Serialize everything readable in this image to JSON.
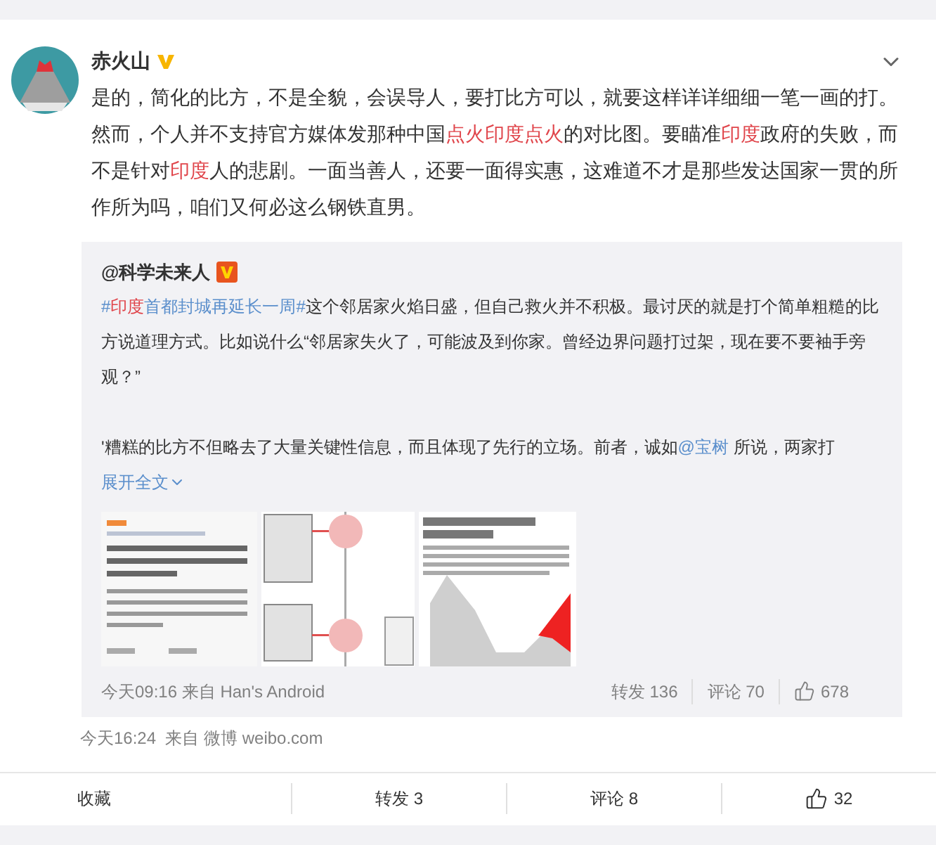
{
  "post": {
    "author": "赤火山",
    "verified": true,
    "body": [
      {
        "kind": "plain",
        "text": "是的，简化的比方，不是全貌，会误导人，要打比方可以，就要这样详详细细一笔一画的打。然而，个人并不支持官方媒体发那种中国"
      },
      {
        "kind": "highlight",
        "text": "点火印度点火"
      },
      {
        "kind": "plain",
        "text": "的对比图。要瞄准"
      },
      {
        "kind": "highlight",
        "text": "印度"
      },
      {
        "kind": "plain",
        "text": "政府的失败，而不是针对"
      },
      {
        "kind": "highlight",
        "text": "印度"
      },
      {
        "kind": "plain",
        "text": "人的悲剧。一面当善人，还要一面得实惠，这难道不才是那些发达国家一贯的所作所为吗，咱们又何必这么钢铁直男。"
      }
    ],
    "repost": {
      "author": "@科学未来人",
      "verified": true,
      "paragraphs": [
        [
          {
            "kind": "link",
            "text": "#"
          },
          {
            "kind": "highlight",
            "text": "印度"
          },
          {
            "kind": "link",
            "text": "首都封城再延长一周#"
          },
          {
            "kind": "plain",
            "text": "这个邻居家火焰日盛，但自己救火并不积极。最讨厌的就是打个简单粗糙的比方说道理方式。比如说什么“邻居家失火了，可能波及到你家。曾经边界问题打过架，现在要不要袖手旁观？”"
          }
        ],
        [
          {
            "kind": "plain",
            "text": "'糟糕的比方不但略去了大量关键性信息，而且体现了先行的立场。前者，诚如"
          },
          {
            "kind": "link",
            "text": "@宝树"
          },
          {
            "kind": "plain",
            "text": " 所说，两家打 "
          }
        ]
      ],
      "expand": "展开全文",
      "images": [
        {
          "kind": "picture"
        },
        {
          "kind": "picture"
        },
        {
          "kind": "picture"
        }
      ],
      "time": "今天09:16 来自 Han's Android",
      "stats": [
        {
          "kind": "text",
          "label": "转发 136"
        },
        {
          "kind": "text",
          "label": "评论 70"
        },
        {
          "kind": "like",
          "label": "678"
        }
      ]
    },
    "time": "今天16:24  来自 微博 weibo.com",
    "actions": [
      {
        "kind": "text",
        "label": "收藏"
      },
      {
        "kind": "text",
        "label": "转发 3"
      },
      {
        "kind": "text",
        "label": "评论 8"
      },
      {
        "kind": "like",
        "label": "32"
      }
    ]
  }
}
